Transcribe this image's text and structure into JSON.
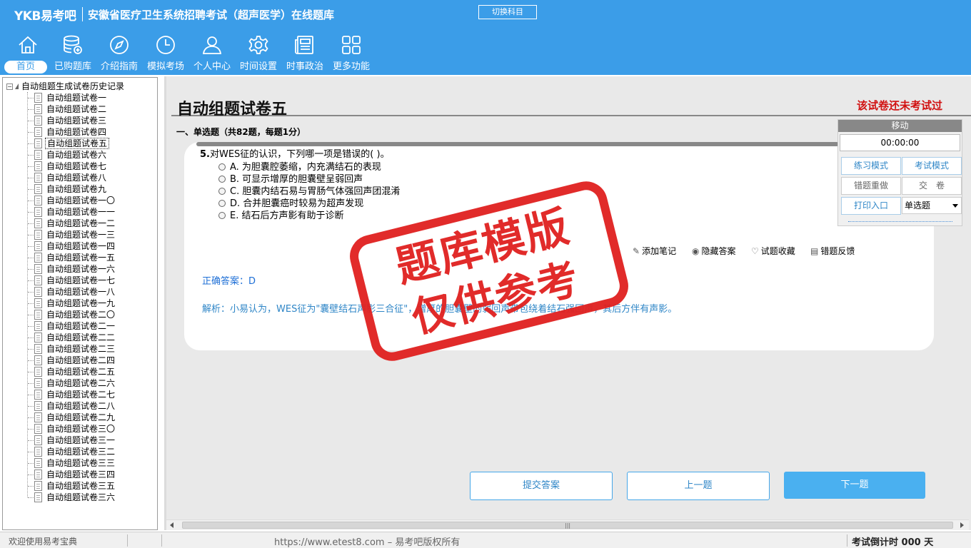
{
  "header": {
    "logo": "YKB易考吧",
    "title": "安徽省医疗卫生系统招聘考试（超声医学）在线题库",
    "switch_subject": "切换科目"
  },
  "nav": [
    {
      "label": "首页",
      "icon": "home-icon"
    },
    {
      "label": "已购题库",
      "icon": "database-icon"
    },
    {
      "label": "介绍指南",
      "icon": "compass-icon"
    },
    {
      "label": "模拟考场",
      "icon": "clock-icon"
    },
    {
      "label": "个人中心",
      "icon": "user-icon"
    },
    {
      "label": "时间设置",
      "icon": "gear-icon"
    },
    {
      "label": "时事政治",
      "icon": "newspaper-icon"
    },
    {
      "label": "更多功能",
      "icon": "grid-icon"
    }
  ],
  "sidebar": {
    "root": "自动组题生成试卷历史记录",
    "items": [
      "自动组题试卷一",
      "自动组题试卷二",
      "自动组题试卷三",
      "自动组题试卷四",
      "自动组题试卷五",
      "自动组题试卷六",
      "自动组题试卷七",
      "自动组题试卷八",
      "自动组题试卷九",
      "自动组题试卷一〇",
      "自动组题试卷一一",
      "自动组题试卷一二",
      "自动组题试卷一三",
      "自动组题试卷一四",
      "自动组题试卷一五",
      "自动组题试卷一六",
      "自动组题试卷一七",
      "自动组题试卷一八",
      "自动组题试卷一九",
      "自动组题试卷二〇",
      "自动组题试卷二一",
      "自动组题试卷二二",
      "自动组题试卷二三",
      "自动组题试卷二四",
      "自动组题试卷二五",
      "自动组题试卷二六",
      "自动组题试卷二七",
      "自动组题试卷二八",
      "自动组题试卷二九",
      "自动组题试卷三〇",
      "自动组题试卷三一",
      "自动组题试卷三二",
      "自动组题试卷三三",
      "自动组题试卷三四",
      "自动组题试卷三五",
      "自动组题试卷三六"
    ],
    "selected_index": 4
  },
  "main": {
    "paper_title": "自动组题试卷五",
    "status_note": "该试卷还未考试过",
    "section_header": "一、单选题（共82题，每题1分）",
    "question": {
      "number": "5.",
      "stem": "对WES征的认识，下列哪一项是错误的(  )。",
      "options": [
        "A. 为胆囊腔萎缩，内充满结石的表现",
        "B. 可显示增厚的胆囊壁呈弱回声",
        "C. 胆囊内结石易与胃肠气体强回声团混淆",
        "D. 合并胆囊癌时较易为超声发现",
        "E. 结石后方声影有助于诊断"
      ]
    },
    "actions": {
      "add_note": "添加笔记",
      "hide_answer": "隐藏答案",
      "favorite": "试题收藏",
      "report_error": "错题反馈"
    },
    "answer": "正确答案：D",
    "analysis": "解析：小易认为，WES征为\"囊壁结石声影三合征\"，增厚的胆囊壁的弱回声带包绕着结石强回声，其后方伴有声影。",
    "buttons": {
      "submit": "提交答案",
      "prev": "上一题",
      "next": "下一题"
    }
  },
  "watermark": {
    "line1": "题库模版",
    "line2": "仅供参考",
    "color": "#e0201f"
  },
  "panel": {
    "move": "移动",
    "timer": "00:00:00",
    "practice_mode": "练习模式",
    "exam_mode": "考试模式",
    "redo_wrong": "错题重做",
    "submit_paper": "交　卷",
    "print": "打印入口",
    "question_type": "单选题"
  },
  "statusbar": {
    "welcome": "欢迎使用易考宝典",
    "copyright": "https://www.etest8.com – 易考吧版权所有",
    "countdown": "考试倒计时 000 天"
  },
  "colors": {
    "header_bg": "#3b9de8",
    "accent": "#2f86c7",
    "alert": "#d10f0f"
  }
}
